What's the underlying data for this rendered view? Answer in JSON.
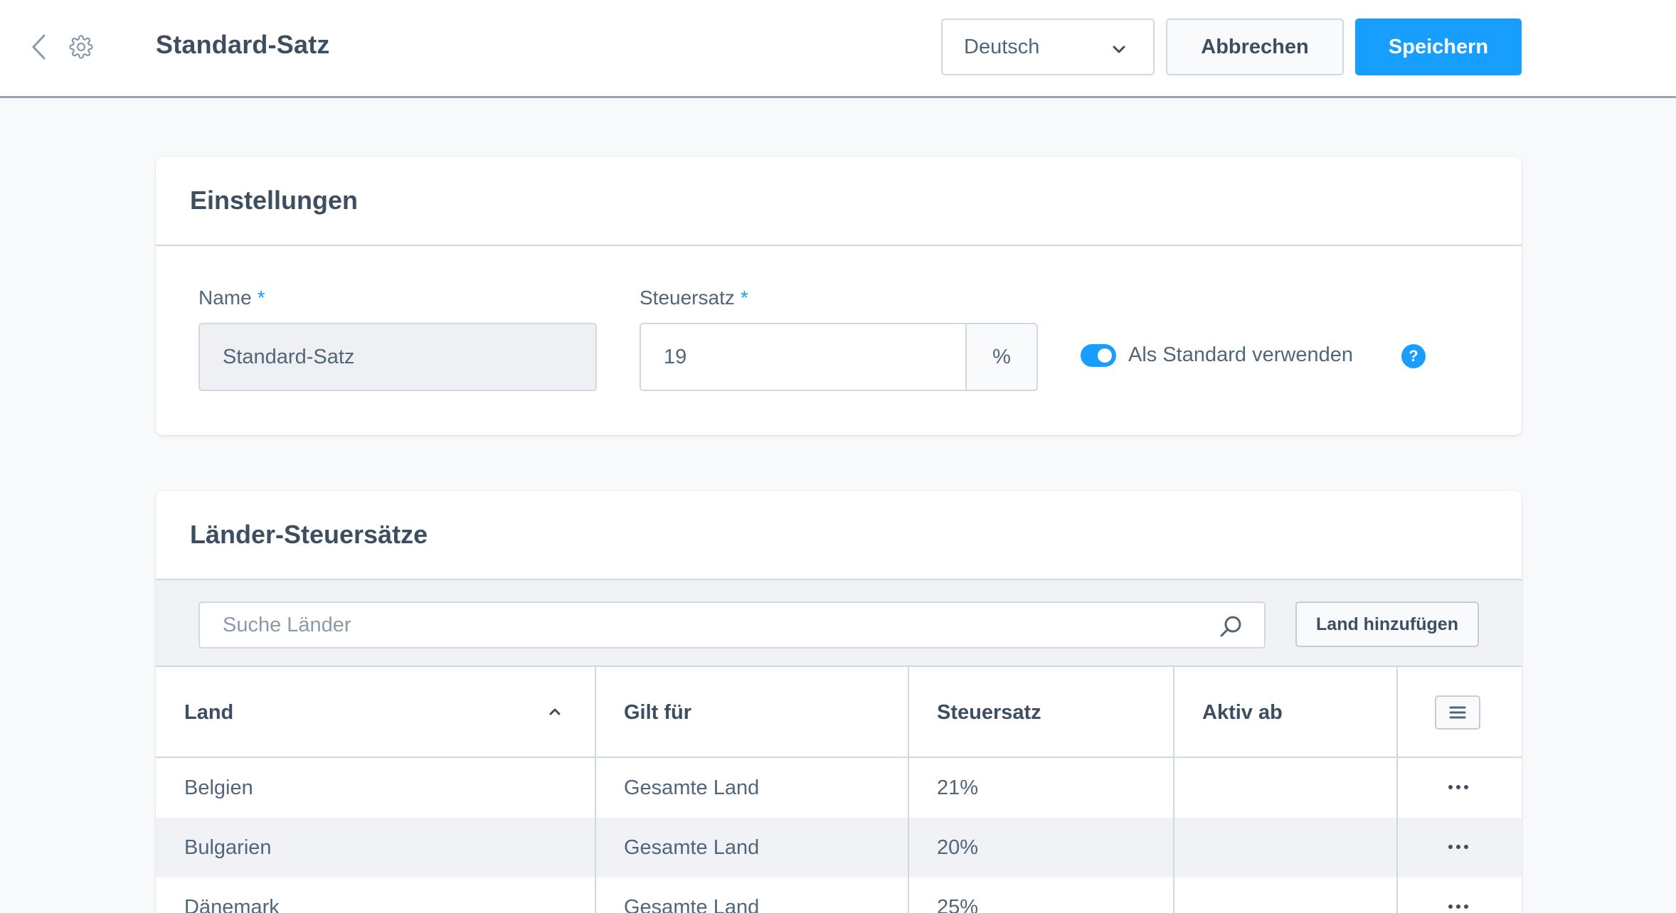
{
  "header": {
    "title": "Standard-Satz",
    "language": "Deutsch",
    "cancel_label": "Abbrechen",
    "save_label": "Speichern"
  },
  "settings": {
    "title": "Einstellungen",
    "name_label": "Name",
    "name_value": "Standard-Satz",
    "rate_label": "Steuersatz",
    "rate_value": "19",
    "rate_suffix": "%",
    "required_marker": "*",
    "default_toggle_label": "Als Standard verwenden",
    "default_toggle_on": true
  },
  "countries": {
    "title": "Länder-Steuersätze",
    "search_placeholder": "Suche Länder",
    "add_label": "Land hinzufügen",
    "columns": [
      "Land",
      "Gilt für",
      "Steuersatz",
      "Aktiv ab"
    ],
    "rows": [
      {
        "country": "Belgien",
        "applies": "Gesamte Land",
        "rate": "21%",
        "active": ""
      },
      {
        "country": "Bulgarien",
        "applies": "Gesamte Land",
        "rate": "20%",
        "active": ""
      },
      {
        "country": "Dänemark",
        "applies": "Gesamte Land",
        "rate": "25%",
        "active": ""
      }
    ]
  },
  "colors": {
    "accent": "#189eff",
    "text": "#52667a",
    "heading": "#3d4e60"
  }
}
